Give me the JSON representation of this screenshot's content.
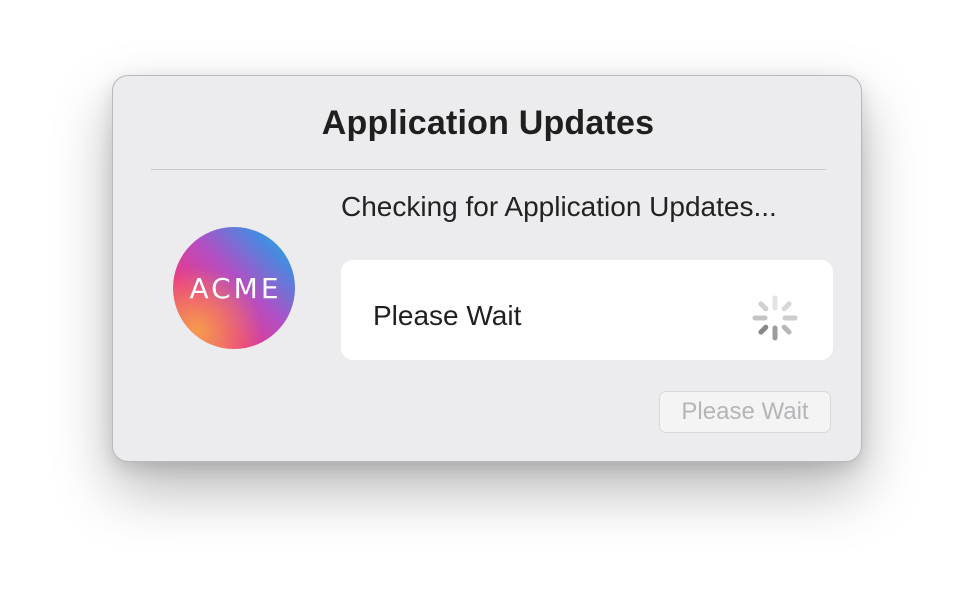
{
  "dialog": {
    "title": "Application Updates",
    "status_text": "Checking for Application Updates...",
    "logo": {
      "text": "ACME",
      "gradient_colors": [
        "#f59b4d",
        "#e9398a",
        "#b24fc4",
        "#4d86e0",
        "#19b9d8"
      ]
    },
    "progress": {
      "label": "Please Wait",
      "indicator": "spinner-icon"
    },
    "button": {
      "label": "Please Wait",
      "enabled": false
    }
  }
}
